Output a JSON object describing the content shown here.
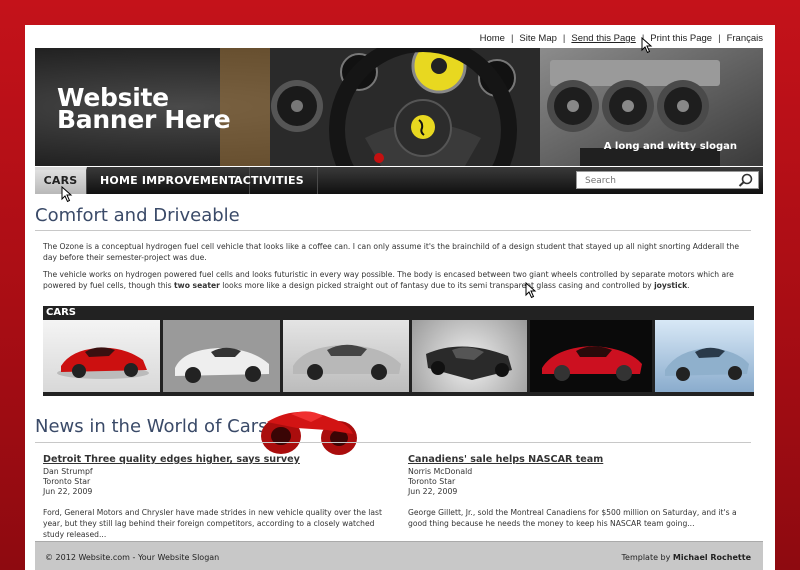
{
  "top_links": {
    "home": "Home",
    "sitemap": "Site Map",
    "send": "Send this Page",
    "print": "Print this Page",
    "francais": "Français",
    "separator": "|"
  },
  "banner": {
    "title": "Website\nBanner Here",
    "slogan": "A long and witty slogan"
  },
  "nav": {
    "items": [
      {
        "label": "CARS"
      },
      {
        "label": "HOME IMPROVEMENT"
      },
      {
        "label": "ACTIVITIES"
      }
    ],
    "search_placeholder": "Search"
  },
  "main": {
    "title": "Comfort and Driveable",
    "paragraph1": "The Ozone is a conceptual hydrogen fuel cell vehicle that looks like a coffee can. I can only assume it's the brainchild of a design student that stayed up all night snorting Adderall the day before their semester-project was due.",
    "paragraph2_before": "The vehicle works on hydrogen powered fuel cells and looks futuristic in every way possible. The body is encased between two giant wheels controlled by separate motors which are powered by fuel cells, though this ",
    "paragraph2_bold": "two seater",
    "paragraph2_after": " looks more like a design picked straight out of fantasy due to its semi transparent glass casing and controlled by ",
    "paragraph2_bold2": "joystick",
    "paragraph2_end": "."
  },
  "gallery": {
    "title": "CARS"
  },
  "news": {
    "title": "News in the World of Cars",
    "items": [
      {
        "headline": "Detroit Three quality edges higher, says survey",
        "author": "Dan Strumpf",
        "source": "Toronto Star",
        "date": "Jun 22, 2009",
        "body": "Ford, General Motors and Chrysler have made strides in new vehicle quality over the last year, but they still lag behind their foreign competitors, according to a closely watched study released..."
      },
      {
        "headline": "Canadiens' sale helps NASCAR team",
        "author": "Norris McDonald",
        "source": "Toronto Star",
        "date": "Jun 22, 2009",
        "body": "George Gillett, Jr., sold the Montreal Canadiens for $500 million on Saturday, and it's a good thing because he needs the money to keep his NASCAR team going..."
      }
    ]
  },
  "footer": {
    "copyright": "© 2012 Website.com - Your Website Slogan",
    "template_by": "Template by ",
    "author": "Michael Rochette"
  },
  "colors": {
    "background_red": "#c4121a",
    "heading_blue": "#3a4a68",
    "car_red": "#cc1010"
  }
}
